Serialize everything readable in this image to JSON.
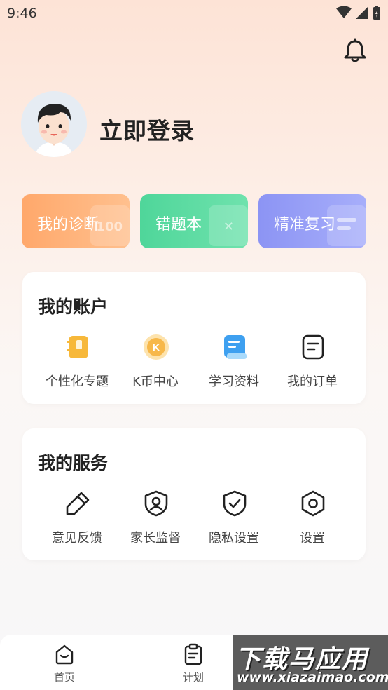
{
  "status_bar": {
    "time": "9:46"
  },
  "profile": {
    "login_text": "立即登录"
  },
  "quick_cards": [
    {
      "label": "我的诊断",
      "deco_text": "100",
      "color_from": "#ffa86b",
      "color_to": "#ffc08e"
    },
    {
      "label": "错题本",
      "deco_text": "✕",
      "color_from": "#4fd69a",
      "color_to": "#6fe2ad"
    },
    {
      "label": "精准复习",
      "deco_text": "",
      "color_from": "#8c94f4",
      "color_to": "#a7aefa"
    }
  ],
  "account_section": {
    "title": "我的账户",
    "items": [
      {
        "label": "个性化专题",
        "icon": "notebook-icon"
      },
      {
        "label": "K币中心",
        "icon": "k-coin-icon"
      },
      {
        "label": "学习资料",
        "icon": "document-icon"
      },
      {
        "label": "我的订单",
        "icon": "order-icon"
      }
    ]
  },
  "service_section": {
    "title": "我的服务",
    "items": [
      {
        "label": "意见反馈",
        "icon": "pencil-icon"
      },
      {
        "label": "家长监督",
        "icon": "user-shield-icon"
      },
      {
        "label": "隐私设置",
        "icon": "check-shield-icon"
      },
      {
        "label": "设置",
        "icon": "hexagon-settings-icon"
      }
    ]
  },
  "bottom_nav": {
    "items": [
      {
        "label": "首页",
        "icon": "home-icon"
      },
      {
        "label": "计划",
        "icon": "clipboard-icon"
      }
    ]
  },
  "watermark": {
    "title": "下载马应用",
    "url": "www.xiazaimao.com"
  },
  "colors": {
    "accent_orange": "#ffa86b",
    "accent_green": "#4fd69a",
    "accent_purple": "#8c94f4",
    "coin_yellow": "#f7b84a",
    "doc_blue": "#3ea0f0"
  }
}
